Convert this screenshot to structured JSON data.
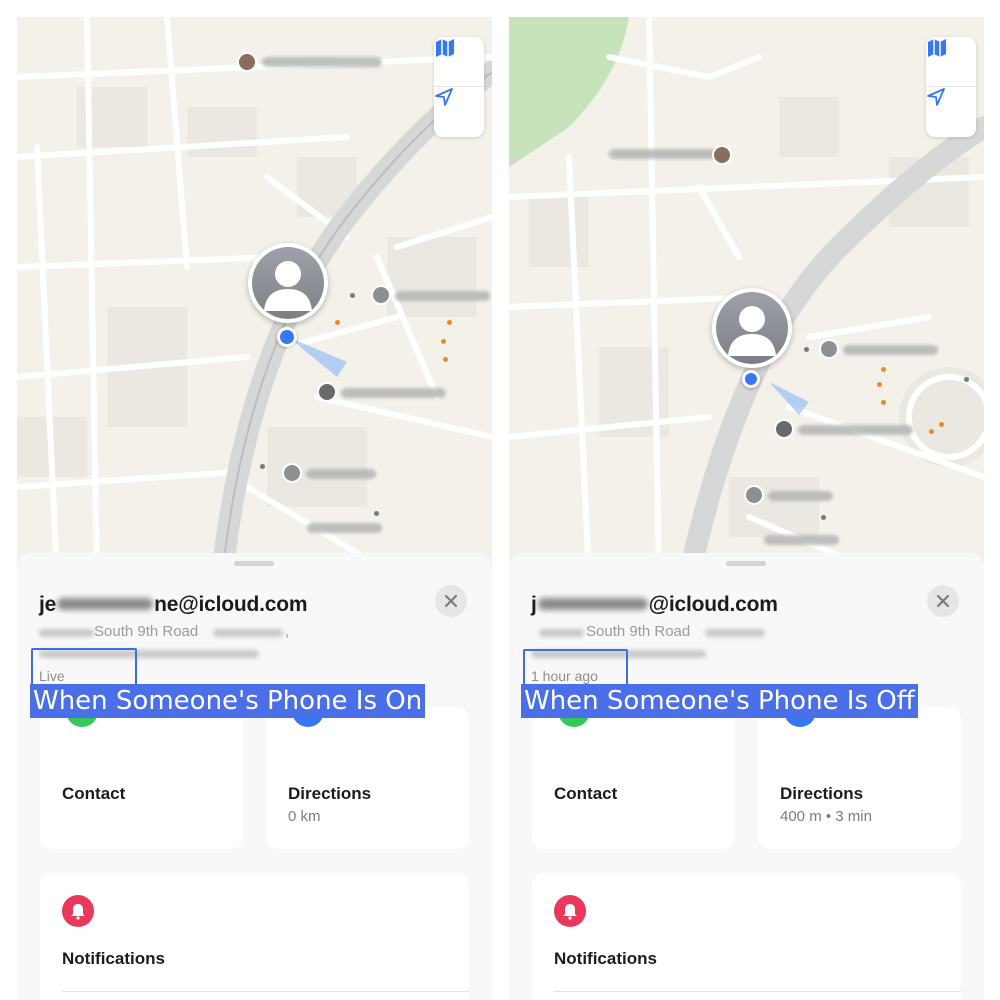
{
  "panels": [
    {
      "id": "left",
      "email_start": "je",
      "email_end": "ne@icloud.com",
      "address": "South 9th Road",
      "address_suffix": ",",
      "status": "Live",
      "banner": "When Someone's Phone Is On",
      "contact_label": "Contact",
      "directions_label": "Directions",
      "directions_sub": "0 km",
      "notifications_label": "Notifications"
    },
    {
      "id": "right",
      "email_start": "j",
      "email_end": "@icloud.com",
      "address": "South 9th Road",
      "address_suffix": "",
      "status": "1 hour ago",
      "banner": "When Someone's Phone Is Off",
      "contact_label": "Contact",
      "directions_label": "Directions",
      "directions_sub": "400 m • 3 min",
      "notifications_label": "Notifications"
    }
  ],
  "icons": {
    "map_mode": "map-icon",
    "locate": "location-arrow-icon",
    "close": "close-icon",
    "notifications": "bell-icon",
    "contact": "contact-icon",
    "directions": "directions-icon"
  },
  "colors": {
    "accent_blue": "#3478f6",
    "highlight_box": "#3e6de6",
    "banner_bg": "#4a6fe8",
    "contact_green": "#34c759",
    "notification_red": "#e8395c",
    "map_background": "#f4f1ea"
  }
}
